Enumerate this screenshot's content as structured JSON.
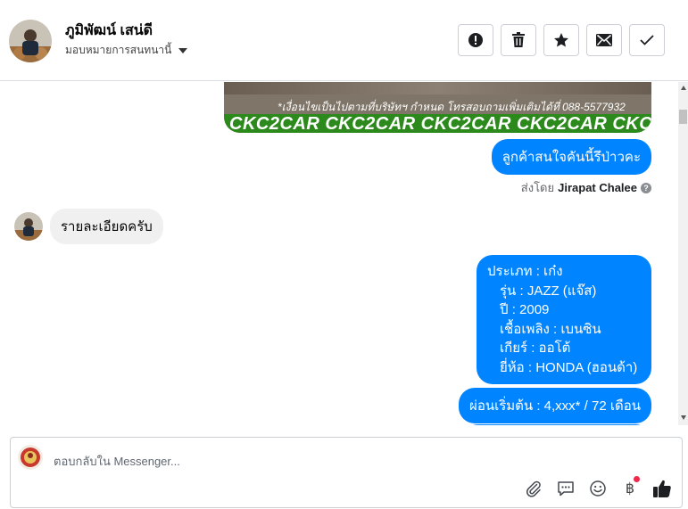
{
  "header": {
    "contact_name": "ภูมิพัฒน์ เสน่ดี",
    "assign_label": "มอบหมายการสนทนานี้",
    "actions": [
      {
        "name": "mark-spam-button",
        "icon": "exclamation-icon"
      },
      {
        "name": "delete-button",
        "icon": "trash-icon"
      },
      {
        "name": "star-button",
        "icon": "star-icon"
      },
      {
        "name": "mark-unread-button",
        "icon": "envelope-icon"
      },
      {
        "name": "mark-done-button",
        "icon": "check-icon"
      }
    ]
  },
  "thread": {
    "image_card": {
      "promo_line": "*เงื่อนไขเป็นไปตามที่บริษัทฯ กำหนด โทรสอบถามเพิ่มเติมได้ที่ 088-5577932",
      "brand_strip": "CKC2CAR CKC2CAR CKC2CAR CKC2CAR CKC2CAR CKC2"
    },
    "msg_interest": "ลูกค้าสนใจคันนี้รึป่าวคะ",
    "sent_by_prefix": "ส่งโดย",
    "sent_by_name": "Jirapat Chalee",
    "msg_details_request": "รายละเอียดครับ",
    "details": {
      "type": "ประเภท : เก๋ง",
      "model": "รุ่น : JAZZ (แจ๊ส)",
      "year": "ปี : 2009",
      "fuel": "เชื้อเพลิง : เบนซิน",
      "gear": "เกียร์ : ออโต้",
      "brand": "ยี่ห้อ : HONDA (ฮอนด้า)"
    },
    "msg_installment": "ผ่อนเริ่มต้น : 4,xxx* / 72 เดือน"
  },
  "composer": {
    "placeholder": "ตอบกลับใน Messenger...",
    "tools": [
      "paperclip-icon",
      "quick-reply-icon",
      "emoji-icon",
      "baht-payment-icon",
      "thumbs-up-icon"
    ],
    "baht_symbol": "฿"
  },
  "colors": {
    "accent": "#0084ff",
    "incoming_bubble": "#f0f0f0",
    "notification_dot": "#f02849"
  }
}
